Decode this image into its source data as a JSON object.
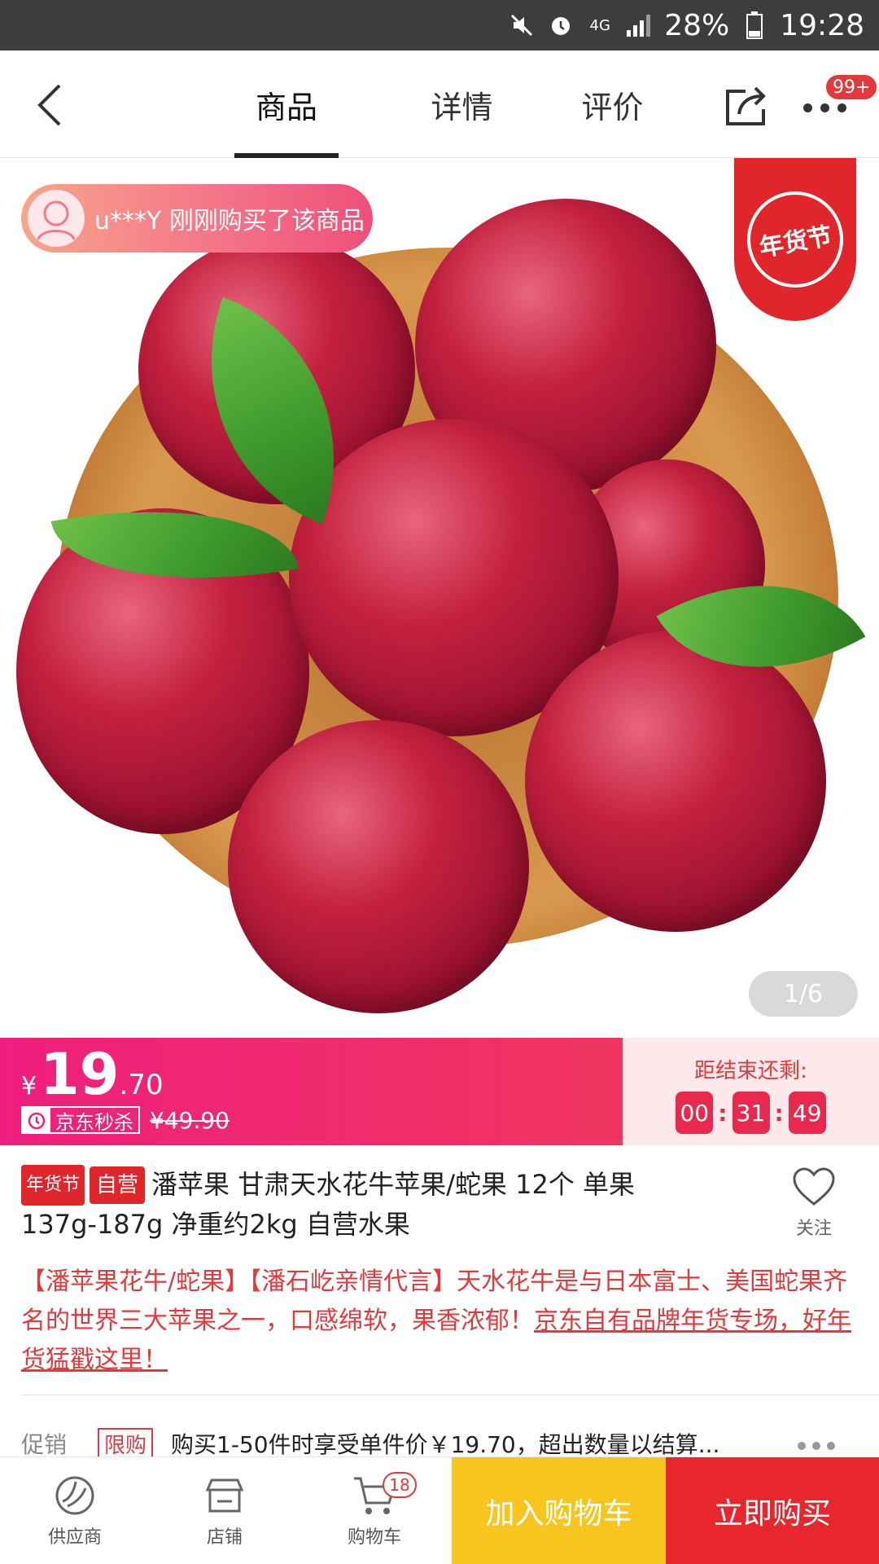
{
  "status_bar": {
    "battery": "28%",
    "time": "19:28",
    "network": "4G"
  },
  "nav": {
    "tabs": [
      {
        "label": "商品"
      },
      {
        "label": "详情"
      },
      {
        "label": "评价"
      }
    ],
    "message_badge": "99+"
  },
  "hero": {
    "buyer_toast": "u***Y 刚刚购买了该商品",
    "festival_tag": "年货节",
    "pager": "1/6"
  },
  "price": {
    "currency": "¥",
    "integer": "19",
    "decimal": ".70",
    "seckill_label": "京东秒杀",
    "original": "¥49.90",
    "countdown_label": "距结束还剩:",
    "countdown": {
      "hours": "00",
      "minutes": "31",
      "seconds": "49"
    }
  },
  "product": {
    "tag_festival": "年货节",
    "tag_self": "自营",
    "title_part1": "潘苹果 甘肃天水花牛苹果/蛇果 12个 单果",
    "title_part2": "137g-187g 净重约2kg 自营水果",
    "follow_label": "关注",
    "desc_text": "【潘苹果花牛/蛇果】【潘石屹亲情代言】天水花牛是与日本富士、美国蛇果齐名的世界三大苹果之一，口感绵软，果香浓郁！",
    "desc_link": "京东自有品牌年货专场，好年货猛戳这里！"
  },
  "promotion": {
    "label": "促销",
    "badge": "限购",
    "text": "购买1-50件时享受单件价￥19.70，超出数量以结算..."
  },
  "bottom_bar": {
    "supplier": "供应商",
    "shop": "店铺",
    "cart": "购物车",
    "cart_count": "18",
    "add_to_cart": "加入购物车",
    "buy_now": "立即购买"
  },
  "colors": {
    "brand_red": "#e4393c",
    "price_gradient_start": "#ef1f7e",
    "add_to_cart": "#f8c41e",
    "buy_now": "#e8262e"
  }
}
